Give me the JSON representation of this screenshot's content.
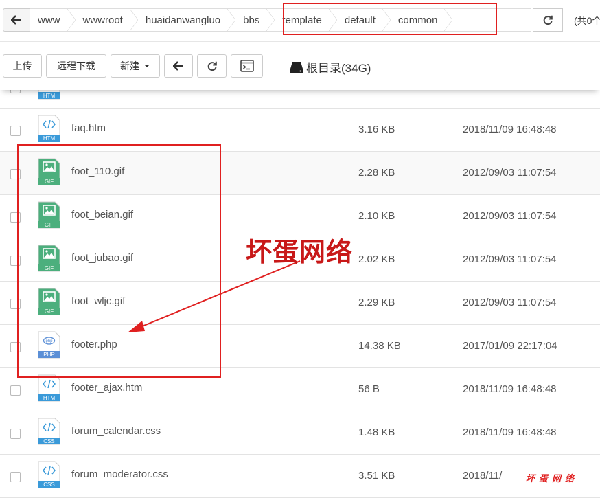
{
  "breadcrumbs": [
    "www",
    "wwwroot",
    "huaidanwangluo",
    "bbs",
    "template",
    "default",
    "common"
  ],
  "total_text": "(共0个",
  "toolbar": {
    "upload": "上传",
    "remote_download": "远程下载",
    "new": "新建",
    "disk_label": "根目录(34G)"
  },
  "files": [
    {
      "name": "faq.htm",
      "type": "HTM",
      "size": "3.16 KB",
      "date": "2018/11/09 16:48:48"
    },
    {
      "name": "foot_110.gif",
      "type": "GIF",
      "size": "2.28 KB",
      "date": "2012/09/03 11:07:54"
    },
    {
      "name": "foot_beian.gif",
      "type": "GIF",
      "size": "2.10 KB",
      "date": "2012/09/03 11:07:54"
    },
    {
      "name": "foot_jubao.gif",
      "type": "GIF",
      "size": "2.02 KB",
      "date": "2012/09/03 11:07:54"
    },
    {
      "name": "foot_wljc.gif",
      "type": "GIF",
      "size": "2.29 KB",
      "date": "2012/09/03 11:07:54"
    },
    {
      "name": "footer.php",
      "type": "PHP",
      "size": "14.38 KB",
      "date": "2017/01/09 22:17:04"
    },
    {
      "name": "footer_ajax.htm",
      "type": "HTM",
      "size": "56 B",
      "date": "2018/11/09 16:48:48"
    },
    {
      "name": "forum_calendar.css",
      "type": "CSS",
      "size": "1.48 KB",
      "date": "2018/11/09 16:48:48"
    },
    {
      "name": "forum_moderator.css",
      "type": "CSS",
      "size": "3.51 KB",
      "date": "2018/11/"
    }
  ],
  "annotation": {
    "watermark": "坏蛋网络",
    "watermark_small": "坏蛋网络",
    "highlight_color": "#e02020"
  },
  "icon_colors": {
    "HTM": "#3a9ad9",
    "GIF": "#4caf7d",
    "PHP": "#5b8fd6",
    "CSS": "#3a9ad9"
  }
}
